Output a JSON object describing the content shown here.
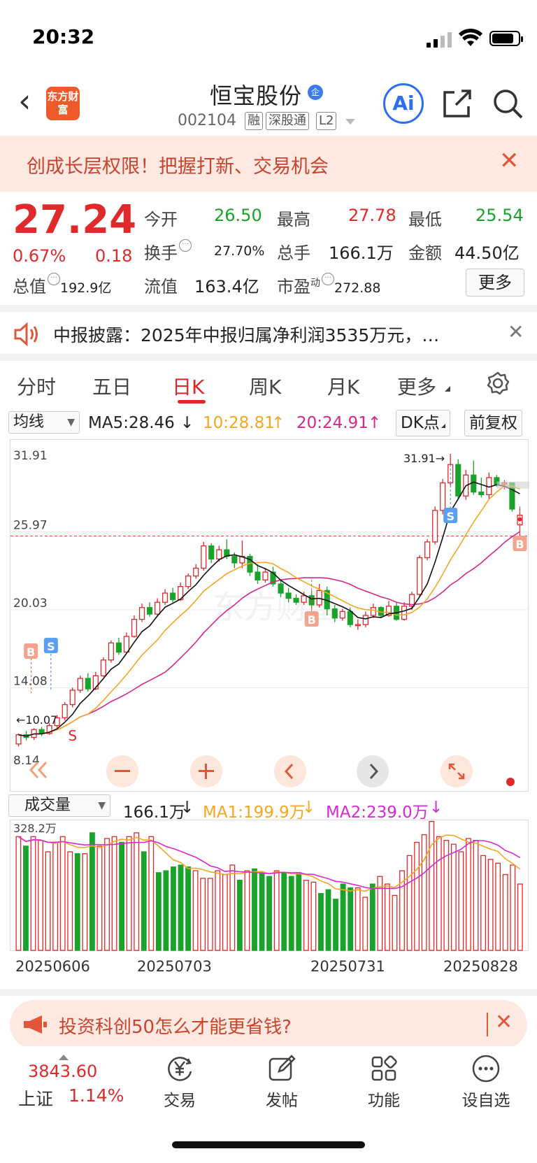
{
  "status": {
    "time": "20:32"
  },
  "header": {
    "logo": "东方财富",
    "name": "恒宝股份",
    "qi_badge": "企",
    "code": "002104",
    "tags": [
      "融",
      "深股通",
      "L2"
    ],
    "ai": "Ai"
  },
  "banner": {
    "text": "创成长层权限！把握打新、交易机会"
  },
  "quote": {
    "price": "27.24",
    "pct": "0.67%",
    "change": "0.18",
    "open_label": "今开",
    "open": "26.50",
    "high_label": "最高",
    "high": "27.78",
    "low_label": "最低",
    "low": "25.54",
    "turnover_label": "换手",
    "turnover": "27.70%",
    "volume_label": "总手",
    "volume": "166.1万",
    "amount_label": "金额",
    "amount": "44.50亿",
    "mktcap_label": "总值",
    "mktcap": "192.9亿",
    "float_label": "流值",
    "float": "163.4亿",
    "pe_label": "市盈",
    "pe_sup": "动",
    "pe": "272.88",
    "more": "更多"
  },
  "notice": {
    "text": "中报披露：2025年中报归属净利润3535万元，…"
  },
  "tabs": [
    "分时",
    "五日",
    "日K",
    "周K",
    "月K",
    "更多"
  ],
  "active_tab": "日K",
  "kline_bar": {
    "select": "均线",
    "ma5": "MA5:28.46",
    "ma10": "10:28.81",
    "ma20": "20:24.91",
    "dk": "DK点",
    "fq": "前复权"
  },
  "volume_bar": {
    "select": "成交量",
    "vol": "166.1万",
    "ma1": "MA1:199.9万",
    "ma2": "MA2:239.0万"
  },
  "colors": {
    "up": "#e0292b",
    "down": "#1aa32a",
    "ma5": "#111111",
    "ma10": "#f5a623",
    "ma20": "#d6278c",
    "vma1": "#f5a623",
    "vma2": "#d42ad6"
  },
  "chart_data": {
    "type": "candlestick",
    "y_ticks": [
      "31.91",
      "25.97",
      "20.03",
      "14.08",
      "8.14"
    ],
    "ylim": [
      8.14,
      31.91
    ],
    "ref_line": 25.97,
    "max_label": "31.91→",
    "min_label": "←10.07",
    "markers": [
      {
        "label": "B"
      },
      {
        "label": "S"
      },
      {
        "label": "S"
      },
      {
        "label": "B"
      },
      {
        "label": "S"
      },
      {
        "label": "B"
      }
    ],
    "candles": [
      [
        9.8,
        10.5,
        9.6,
        10.6
      ],
      [
        10.5,
        10.3,
        10.07,
        10.8
      ],
      [
        10.3,
        10.9,
        10.1,
        11.0
      ],
      [
        10.9,
        10.6,
        10.4,
        11.1
      ],
      [
        10.6,
        11.2,
        10.5,
        11.4
      ],
      [
        11.2,
        11.8,
        11.0,
        12.0
      ],
      [
        11.8,
        12.8,
        11.6,
        13.0
      ],
      [
        12.8,
        13.9,
        12.6,
        14.1
      ],
      [
        13.9,
        14.8,
        13.7,
        15.0
      ],
      [
        14.8,
        14.0,
        13.8,
        15.2
      ],
      [
        14.0,
        15.0,
        13.9,
        15.3
      ],
      [
        15.0,
        16.2,
        14.9,
        16.4
      ],
      [
        16.2,
        17.5,
        16.0,
        17.7
      ],
      [
        17.5,
        16.8,
        16.6,
        17.9
      ],
      [
        16.8,
        18.0,
        16.7,
        18.3
      ],
      [
        18.0,
        19.3,
        17.9,
        19.6
      ],
      [
        19.3,
        20.2,
        19.1,
        20.5
      ],
      [
        20.2,
        19.7,
        19.5,
        20.6
      ],
      [
        19.7,
        20.6,
        19.5,
        20.9
      ],
      [
        20.6,
        21.3,
        20.4,
        21.6
      ],
      [
        21.3,
        20.8,
        20.6,
        21.7
      ],
      [
        20.8,
        21.8,
        20.7,
        22.1
      ],
      [
        21.8,
        22.6,
        21.6,
        22.8
      ],
      [
        22.6,
        23.2,
        22.4,
        23.5
      ],
      [
        23.2,
        24.9,
        23.0,
        25.2
      ],
      [
        24.9,
        23.9,
        23.6,
        25.1
      ],
      [
        23.9,
        24.6,
        23.7,
        24.9
      ],
      [
        24.6,
        24.1,
        23.9,
        25.4
      ],
      [
        24.1,
        23.6,
        23.2,
        24.4
      ],
      [
        23.6,
        24.1,
        23.2,
        25.3
      ],
      [
        24.1,
        22.9,
        22.6,
        24.3
      ],
      [
        22.9,
        22.3,
        22.0,
        23.5
      ],
      [
        22.3,
        22.9,
        22.1,
        23.2
      ],
      [
        22.9,
        22.0,
        21.8,
        23.3
      ],
      [
        22.0,
        21.3,
        21.0,
        22.3
      ],
      [
        21.3,
        20.9,
        20.6,
        21.7
      ],
      [
        20.9,
        20.6,
        20.4,
        21.2
      ],
      [
        20.6,
        21.1,
        20.4,
        21.4
      ],
      [
        21.1,
        20.4,
        20.1,
        21.5
      ],
      [
        20.4,
        21.5,
        20.2,
        22.0
      ],
      [
        21.5,
        20.1,
        19.6,
        21.8
      ],
      [
        20.1,
        19.4,
        19.1,
        20.4
      ],
      [
        19.4,
        19.9,
        19.2,
        20.1
      ],
      [
        19.9,
        18.9,
        18.7,
        20.2
      ],
      [
        18.9,
        18.9,
        18.5,
        19.3
      ],
      [
        18.9,
        19.6,
        18.7,
        19.9
      ],
      [
        19.6,
        20.2,
        19.4,
        20.5
      ],
      [
        20.2,
        19.6,
        19.4,
        20.3
      ],
      [
        19.6,
        20.3,
        19.5,
        20.7
      ],
      [
        20.3,
        19.3,
        19.2,
        20.6
      ],
      [
        19.3,
        20.3,
        19.2,
        20.6
      ],
      [
        20.3,
        21.2,
        20.0,
        21.4
      ],
      [
        21.2,
        24.0,
        21.0,
        24.2
      ],
      [
        24.0,
        25.2,
        23.8,
        25.4
      ],
      [
        25.2,
        27.6,
        25.0,
        27.9
      ],
      [
        27.6,
        29.7,
        27.3,
        30.0
      ],
      [
        29.7,
        31.1,
        29.5,
        31.91
      ],
      [
        31.1,
        28.7,
        28.5,
        31.5
      ],
      [
        28.7,
        30.3,
        28.4,
        30.7
      ],
      [
        30.3,
        29.0,
        28.8,
        31.4
      ],
      [
        29.0,
        28.8,
        28.6,
        30.1
      ],
      [
        28.8,
        30.1,
        28.5,
        30.5
      ],
      [
        30.1,
        29.6,
        29.4,
        30.3
      ],
      [
        29.6,
        29.7,
        29.2,
        29.9
      ],
      [
        29.7,
        27.7,
        27.5,
        28.5
      ],
      [
        26.5,
        27.24,
        25.54,
        27.78
      ]
    ]
  },
  "volume_data": {
    "ylabel": "328.2万",
    "max": 328.2,
    "values": [
      300,
      275,
      300,
      290,
      260,
      285,
      300,
      260,
      255,
      255,
      310,
      275,
      295,
      300,
      285,
      300,
      310,
      260,
      300,
      205,
      210,
      220,
      225,
      220,
      210,
      190,
      190,
      210,
      200,
      225,
      185,
      210,
      215,
      205,
      195,
      210,
      205,
      195,
      205,
      185,
      180,
      150,
      160,
      135,
      175,
      165,
      165,
      140,
      175,
      195,
      175,
      145,
      210,
      250,
      285,
      305,
      340,
      300,
      290,
      280,
      260,
      295,
      290,
      250,
      240,
      230,
      200,
      225,
      175
    ],
    "up": [
      1,
      0,
      1,
      1,
      1,
      1,
      1,
      1,
      0,
      1,
      0,
      1,
      1,
      1,
      0,
      1,
      1,
      0,
      1,
      0,
      0,
      0,
      0,
      0,
      1,
      1,
      1,
      1,
      1,
      1,
      0,
      1,
      0,
      0,
      0,
      1,
      0,
      0,
      0,
      1,
      1,
      0,
      0,
      0,
      0,
      0,
      1,
      1,
      0,
      1,
      1,
      1,
      1,
      1,
      1,
      1,
      1,
      1,
      1,
      1,
      1,
      1,
      1,
      1,
      1,
      1,
      1,
      1,
      1
    ],
    "dates": [
      "20250606",
      "20250703",
      "20250731",
      "20250828"
    ]
  },
  "ad": {
    "text": "投资科创50怎么才能更省钱?"
  },
  "bottom": {
    "index_value": "3843.60",
    "index_name": "上证",
    "index_pct": "1.14%",
    "items": [
      "交易",
      "发帖",
      "功能",
      "设自选"
    ]
  }
}
